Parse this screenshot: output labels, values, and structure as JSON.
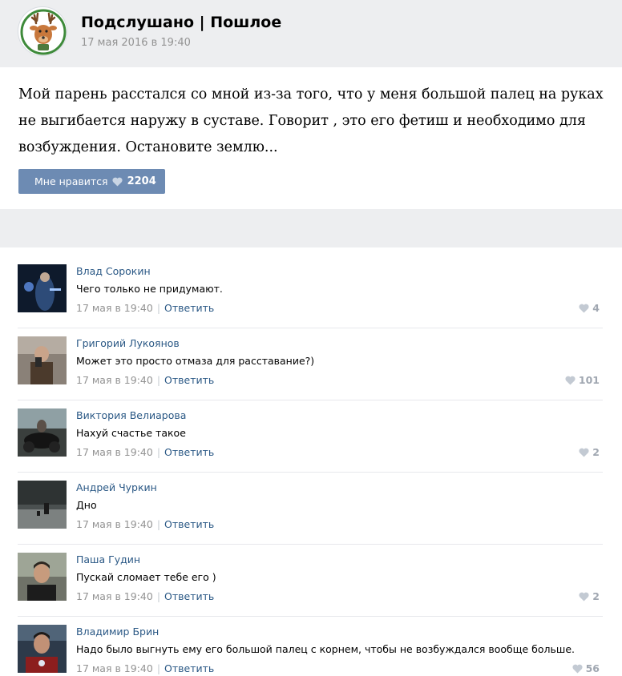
{
  "post": {
    "group_name": "Подслушано | Пошлое",
    "date": "17 мая 2016 в 19:40",
    "text": "Мой парень расстался со мной из-за того, что у меня большой палец на руках не выгибается наружу в суставе. Говорит , это его фетиш и необходимо для возбуждения. Остановите землю...",
    "like_label": "Мне нравится",
    "like_count": "2204"
  },
  "colors": {
    "page_bg": "#edeef0",
    "like_button": "#6d8bb3",
    "link": "#2a5885",
    "muted": "#939393",
    "heart": "#a0a7b1"
  },
  "comments": [
    {
      "author": "Влад Сорокин",
      "text": "Чего только не придумают.",
      "date": "17 мая в 19:40",
      "reply": "Ответить",
      "likes": "4"
    },
    {
      "author": "Григорий Лукоянов",
      "text": "Может это просто отмаза для расставание?)",
      "date": "17 мая в 19:40",
      "reply": "Ответить",
      "likes": "101"
    },
    {
      "author": "Виктория Велиарова",
      "text": "Нахуй счастье такое",
      "date": "17 мая в 19:40",
      "reply": "Ответить",
      "likes": "2"
    },
    {
      "author": "Андрей Чуркин",
      "text": "Дно",
      "date": "17 мая в 19:40",
      "reply": "Ответить",
      "likes": ""
    },
    {
      "author": "Паша Гудин",
      "text": "Пускай сломает тебе его )",
      "date": "17 мая в 19:40",
      "reply": "Ответить",
      "likes": "2"
    },
    {
      "author": "Владимир Брин",
      "text": "Надо было выгнуть ему его большой палец с корнем, чтобы не возбуждался вообще больше.",
      "date": "17 мая в 19:40",
      "reply": "Ответить",
      "likes": "56"
    }
  ]
}
